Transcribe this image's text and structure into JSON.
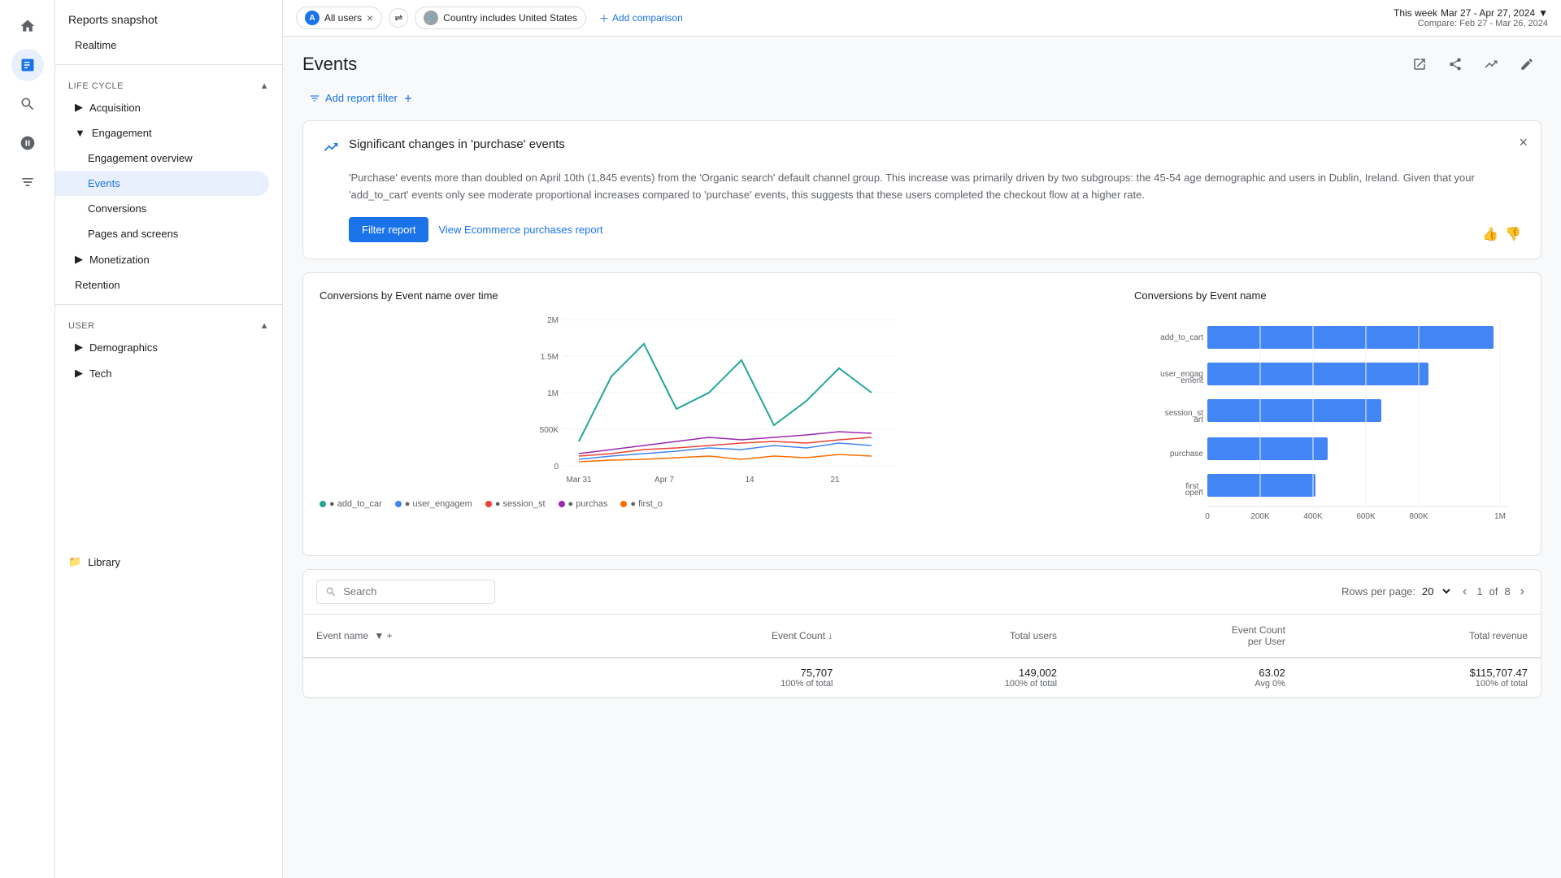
{
  "app": {
    "title": "Reports snapshot"
  },
  "topbar": {
    "filter1_user": "A",
    "filter1_label": "All users",
    "filter2_label": "Country includes United States",
    "add_comparison": "Add comparison",
    "date_label": "This week",
    "date_range": "Mar 27 - Apr 27, 2024",
    "compare_label": "Compare: Feb 27 - Mar 26, 2024"
  },
  "nav": {
    "reports_snapshot": "Reports snapshot",
    "realtime": "Realtime",
    "lifecycle_label": "Life cycle",
    "acquisition": "Acquisition",
    "engagement": "Engagement",
    "engagement_overview": "Engagement overview",
    "events": "Events",
    "conversions": "Conversions",
    "pages_screens": "Pages and screens",
    "monetization": "Monetization",
    "retention": "Retention",
    "user_label": "User",
    "demographics": "Demographics",
    "tech": "Tech",
    "library": "Library"
  },
  "page": {
    "title": "Events",
    "add_filter": "Add report filter"
  },
  "insight": {
    "title": "Significant changes in 'purchase' events",
    "body": "'Purchase' events more than doubled on April 10th (1,845 events) from the 'Organic search' default channel group. This increase was primarily driven by two subgroups: the 45-54 age demographic and users in Dublin, Ireland. Given that your 'add_to_cart' events only see moderate proportional increases compared to 'purchase' events, this suggests that these users completed the checkout flow at a higher rate.",
    "filter_report_btn": "Filter report",
    "view_ecommerce_btn": "View Ecommerce purchases report"
  },
  "line_chart": {
    "title": "Conversions by Event name over time",
    "x_labels": [
      "Mar 31",
      "Apr 7",
      "14",
      "21"
    ],
    "y_labels": [
      "0",
      "500K",
      "1M",
      "1.5M",
      "2M"
    ],
    "legend": [
      {
        "label": "add_to_car",
        "color": "#4285f4"
      },
      {
        "label": "user_engagem",
        "color": "#34a853"
      },
      {
        "label": "session_st",
        "color": "#ea4335"
      },
      {
        "label": "purchas",
        "color": "#9c27b0"
      },
      {
        "label": "first_o",
        "color": "#ff6d00"
      }
    ]
  },
  "bar_chart": {
    "title": "Conversions by Event name",
    "bars": [
      {
        "label": "add_to_cart",
        "value": 950000,
        "max": 1000000
      },
      {
        "label": "user_engagement",
        "value": 780000,
        "max": 1000000
      },
      {
        "label": "session_start",
        "value": 620000,
        "max": 1000000
      },
      {
        "label": "purchase",
        "value": 430000,
        "max": 1000000
      },
      {
        "label": "first_open",
        "value": 390000,
        "max": 1000000
      }
    ],
    "x_labels": [
      "0",
      "200K",
      "400K",
      "600K",
      "800K",
      "1M"
    ],
    "color": "#4285f4"
  },
  "table": {
    "search_placeholder": "Search",
    "rows_per_page_label": "Rows per page:",
    "rows_per_page_value": "20",
    "page_current": "1",
    "page_total": "8",
    "columns": [
      "Event name",
      "Event Count",
      "Total users",
      "Event Count per User",
      "Total revenue"
    ],
    "sort_col": "Event Count",
    "totals": {
      "event_count": "75,707",
      "event_count_pct": "100% of total",
      "total_users": "149,002",
      "total_users_pct": "100% of total",
      "event_per_user": "63.02",
      "event_per_user_sub": "Avg 0%",
      "total_revenue": "$115,707.47",
      "total_revenue_pct": "100% of total"
    }
  }
}
